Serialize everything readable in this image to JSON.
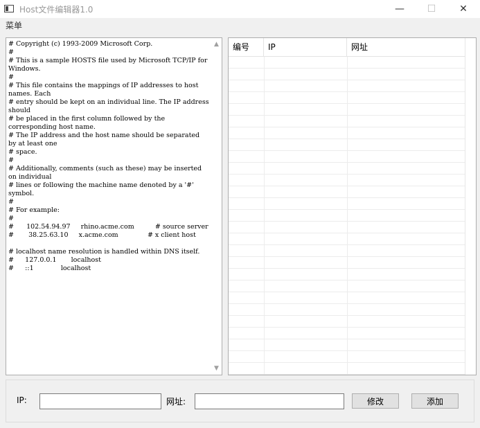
{
  "window": {
    "title": "Host文件编辑器1.0",
    "controls": {
      "minimize": "—",
      "maximize": "☐",
      "close": "✕"
    }
  },
  "menubar": {
    "items": [
      {
        "label": "菜单"
      }
    ]
  },
  "hosts_editor": {
    "content": "# Copyright (c) 1993-2009 Microsoft Corp.\n#\n# This is a sample HOSTS file used by Microsoft TCP/IP for Windows.\n#\n# This file contains the mappings of IP addresses to host names. Each\n# entry should be kept on an individual line. The IP address should\n# be placed in the first column followed by the corresponding host name.\n# The IP address and the host name should be separated by at least one\n# space.\n#\n# Additionally, comments (such as these) may be inserted on individual\n# lines or following the machine name denoted by a '#' symbol.\n#\n# For example:\n#\n#      102.54.94.97     rhino.acme.com          # source server\n#       38.25.63.10     x.acme.com              # x client host\n\n# localhost name resolution is handled within DNS itself.\n#\t127.0.0.1       localhost\n#\t::1             localhost",
    "scroll_up": "▲",
    "scroll_down": "▼"
  },
  "entries_table": {
    "columns": [
      "编号",
      "IP",
      "网址"
    ],
    "rows": []
  },
  "form": {
    "ip_label": "IP:",
    "ip_value": "",
    "url_label": "网址:",
    "url_value": "",
    "edit_button": "修改",
    "add_button": "添加"
  }
}
